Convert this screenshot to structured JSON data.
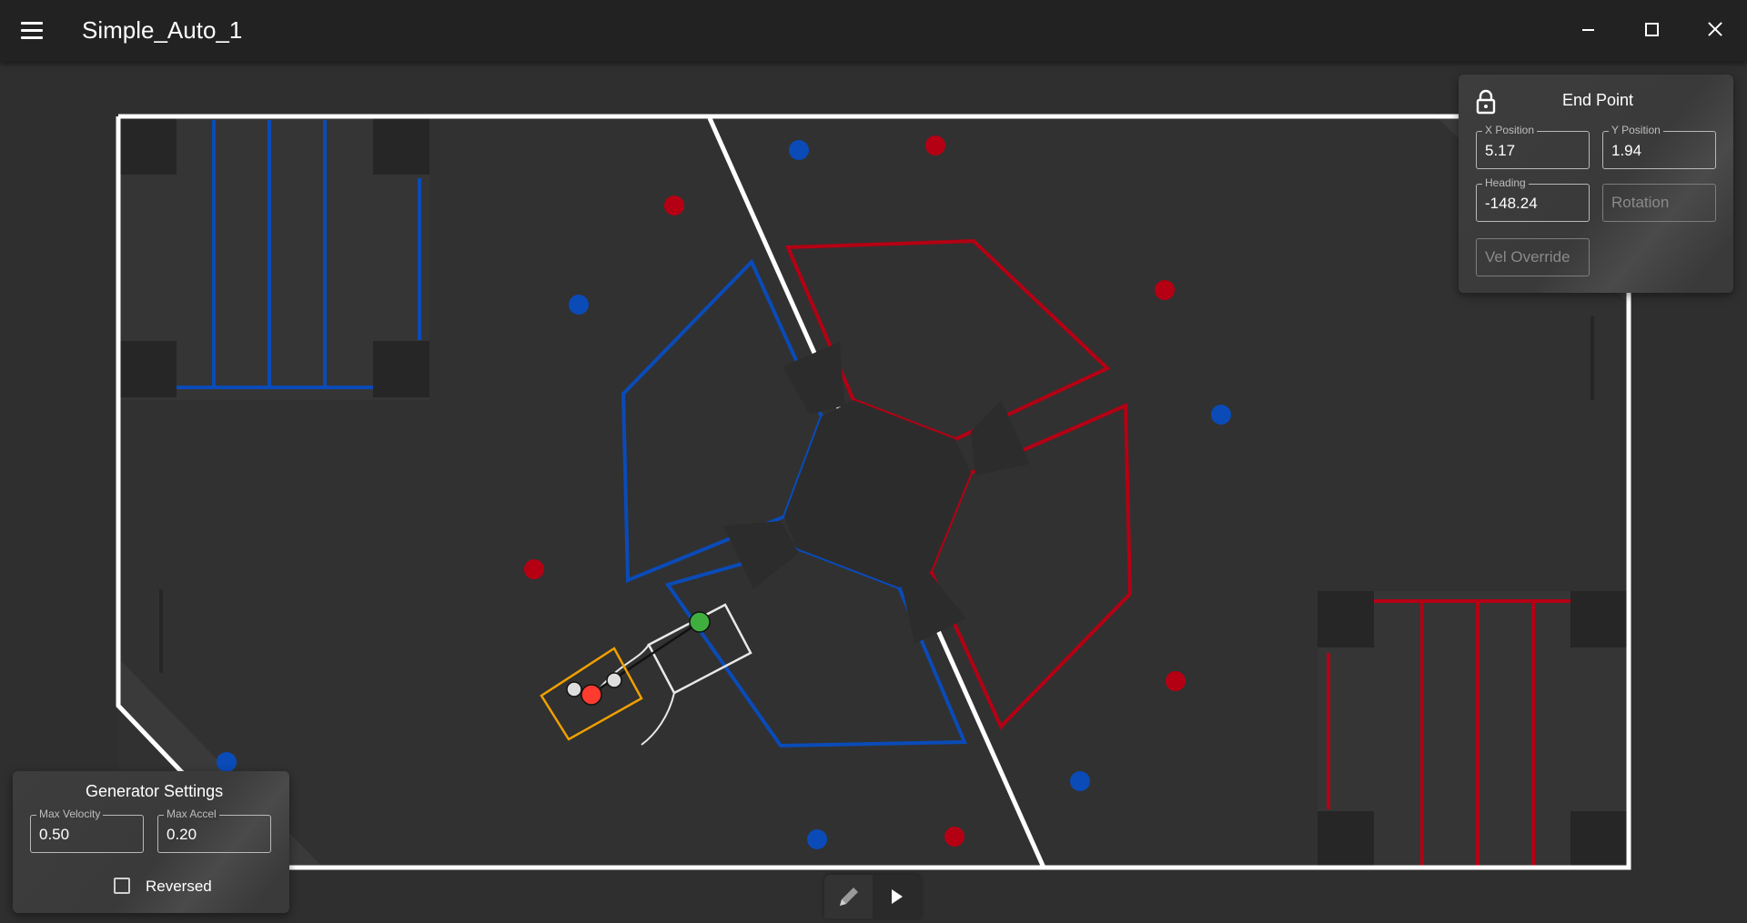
{
  "window": {
    "title": "Simple_Auto_1",
    "menu_icon": "hamburger-menu-icon",
    "controls": [
      "minimize-icon",
      "maximize-icon",
      "close-icon"
    ]
  },
  "end_point_panel": {
    "title": "End Point",
    "lock_icon": "lock-icon",
    "fields": {
      "x_position": {
        "label": "X Position",
        "value": "5.17"
      },
      "y_position": {
        "label": "Y Position",
        "value": "1.94"
      },
      "heading": {
        "label": "Heading",
        "value": "-148.24"
      },
      "rotation": {
        "label": "",
        "value": "Rotation"
      },
      "vel_override": {
        "label": "",
        "value": "Vel Override"
      }
    }
  },
  "generator_panel": {
    "title": "Generator Settings",
    "max_velocity": {
      "label": "Max Velocity",
      "value": "0.50"
    },
    "max_accel": {
      "label": "Max Accel",
      "value": "0.20"
    },
    "reversed": {
      "label": "Reversed",
      "checked": false
    }
  },
  "toolbar": {
    "edit_icon": "pencil-icon",
    "play_icon": "play-icon"
  },
  "colors": {
    "background": "#2f2f2f",
    "titlebar": "#222222",
    "field_line": "#ffffff",
    "blue_alliance": "#0a4bb8",
    "red_alliance": "#b50014",
    "robot_outline": "#f0a000",
    "path_start": "#ff3b30",
    "path_end": "#3fae3f"
  }
}
